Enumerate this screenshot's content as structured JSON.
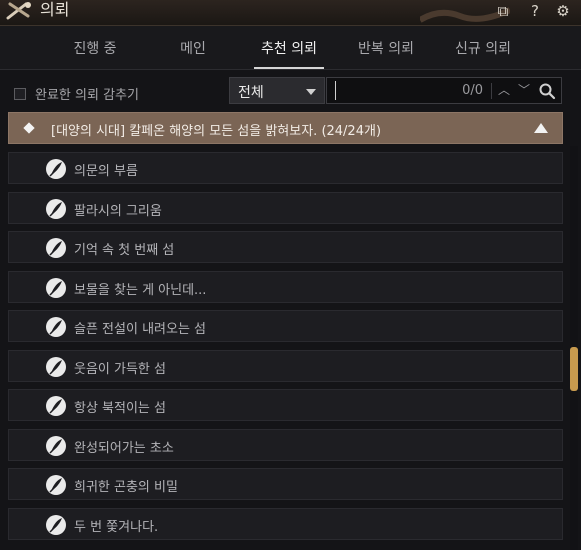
{
  "window": {
    "title": "의뢰"
  },
  "tabs": [
    {
      "label": "진행 중",
      "active": false
    },
    {
      "label": "메인",
      "active": false
    },
    {
      "label": "추천 의뢰",
      "active": true
    },
    {
      "label": "반복 의뢰",
      "active": false
    },
    {
      "label": "신규 의뢰",
      "active": false
    }
  ],
  "filter": {
    "hide_completed_label": "완료한 의뢰 감추기",
    "hide_completed_checked": false,
    "select_value": "전체",
    "search_value": "",
    "search_count": "0/0"
  },
  "group": {
    "title": "[대양의 시대] 칼페온 해양의 모든 섬을 밝혀보자. (24/24개)",
    "expanded": true
  },
  "quests": [
    {
      "label": "의문의 부름"
    },
    {
      "label": "팔라시의 그리움"
    },
    {
      "label": "기억 속 첫 번째 섬"
    },
    {
      "label": "보물을 찾는 게 아닌데..."
    },
    {
      "label": "슬픈 전설이 내려오는 섬"
    },
    {
      "label": "웃음이 가득한 섬"
    },
    {
      "label": "항상 북적이는 섬"
    },
    {
      "label": "완성되어가는 초소"
    },
    {
      "label": "희귀한 곤충의 비밀"
    },
    {
      "label": "두 번 쫓겨나다."
    }
  ],
  "colors": {
    "accent": "#c79a4e",
    "group_header": "#7b6555",
    "row_bg": "#1d1d21"
  },
  "icons": {
    "quest": "feather-quill-icon",
    "window_logo": "crossed-tools-logo"
  }
}
